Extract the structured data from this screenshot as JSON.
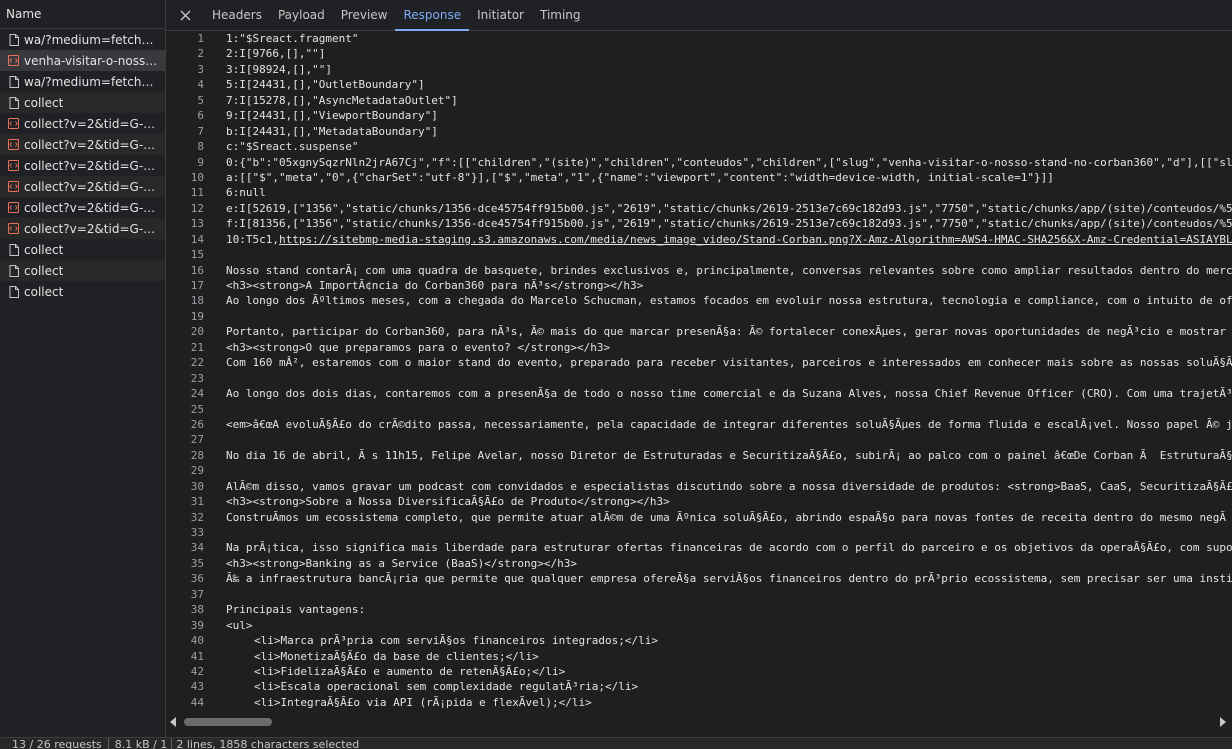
{
  "left_panel": {
    "header": "Name",
    "requests": [
      {
        "name": "wa/?medium=fetch&f...",
        "icon": "document-icon"
      },
      {
        "name": "venha-visitar-o-nosso-s...",
        "icon": "fetch-icon",
        "selected": true
      },
      {
        "name": "wa/?medium=fetch&f...",
        "icon": "document-icon"
      },
      {
        "name": "collect",
        "icon": "document-icon"
      },
      {
        "name": "collect?v=2&tid=G-99V...",
        "icon": "fetch-icon"
      },
      {
        "name": "collect?v=2&tid=G-99V...",
        "icon": "fetch-icon"
      },
      {
        "name": "collect?v=2&tid=G-99V...",
        "icon": "fetch-icon"
      },
      {
        "name": "collect?v=2&tid=G-99V...",
        "icon": "fetch-icon"
      },
      {
        "name": "collect?v=2&tid=G-99V...",
        "icon": "fetch-icon"
      },
      {
        "name": "collect?v=2&tid=G-99V...",
        "icon": "fetch-icon"
      },
      {
        "name": "collect",
        "icon": "document-icon"
      },
      {
        "name": "collect",
        "icon": "document-icon"
      },
      {
        "name": "collect",
        "icon": "document-icon"
      }
    ]
  },
  "tabs": {
    "items": [
      "Headers",
      "Payload",
      "Preview",
      "Response",
      "Initiator",
      "Timing"
    ],
    "active": "Response"
  },
  "response": {
    "lines": [
      {
        "n": "1",
        "t": "1:\"$Sreact.fragment\""
      },
      {
        "n": "2",
        "t": "2:I[9766,[],\"\"]"
      },
      {
        "n": "3",
        "t": "3:I[98924,[],\"\"]"
      },
      {
        "n": "4",
        "t": "5:I[24431,[],\"OutletBoundary\"]"
      },
      {
        "n": "5",
        "t": "7:I[15278,[],\"AsyncMetadataOutlet\"]"
      },
      {
        "n": "6",
        "t": "9:I[24431,[],\"ViewportBoundary\"]"
      },
      {
        "n": "7",
        "t": "b:I[24431,[],\"MetadataBoundary\"]"
      },
      {
        "n": "8",
        "t": "c:\"$Sreact.suspense\""
      },
      {
        "n": "9",
        "t": "0:{\"b\":\"05xgnySqzrNln2jrA67Cj\",\"f\":[[\"children\",\"(site)\",\"children\",\"conteudos\",\"children\",[\"slug\",\"venha-visitar-o-nosso-stand-no-corban360\",\"d\"],[[\"sl"
      },
      {
        "n": "10",
        "t": "a:[[\"$\",\"meta\",\"0\",{\"charSet\":\"utf-8\"}],[\"$\",\"meta\",\"1\",{\"name\":\"viewport\",\"content\":\"width=device-width, initial-scale=1\"}]]"
      },
      {
        "n": "11",
        "t": "6:null"
      },
      {
        "n": "12",
        "t": "e:I[52619,[\"1356\",\"static/chunks/1356-dce45754ff915b00.js\",\"2619\",\"static/chunks/2619-2513e7c69c182d93.js\",\"7750\",\"static/chunks/app/(site)/conteudos/%5"
      },
      {
        "n": "13",
        "t": "f:I[81356,[\"1356\",\"static/chunks/1356-dce45754ff915b00.js\",\"2619\",\"static/chunks/2619-2513e7c69c182d93.js\",\"7750\",\"static/chunks/app/(site)/conteudos/%5"
      },
      {
        "n": "14",
        "t": "10:T5c1,",
        "link": "https://sitebmp-media-staging.s3.amazonaws.com/media/news_image_video/Stand-Corban.png?X-Amz-Algorithm=AWS4-HMAC-SHA256&X-Amz-Credential=ASIAYBL"
      },
      {
        "n": "15",
        "t": ""
      },
      {
        "n": "16",
        "t": "Nosso stand contarÃ¡ com uma quadra de basquete, brindes exclusivos e, principalmente, conversas relevantes sobre como ampliar resultados dentro do merc"
      },
      {
        "n": "17",
        "t": "<h3><strong>A ImportÃ¢ncia do Corban360 para nÃ³s</strong></h3>"
      },
      {
        "n": "18",
        "t": "Ao longo dos Ãºltimos meses, com a chegada do Marcelo Schucman, estamos focados em evoluir nossa estrutura, tecnologia e compliance, com o intuito de of"
      },
      {
        "n": "19",
        "t": ""
      },
      {
        "n": "20",
        "t": "Portanto, participar do Corban360, para nÃ³s, Ã© mais do que marcar presenÃ§a: Ã© fortalecer conexÃµes, gerar novas oportunidades de negÃ³cio e mostrar"
      },
      {
        "n": "21",
        "t": "<h3><strong>O que preparamos para o evento? </strong></h3>"
      },
      {
        "n": "22",
        "t": "Com 160 mÂ², estaremos com o maior stand do evento, preparado para receber visitantes, parceiros e interessados em conhecer mais sobre as nossas soluÃ§Ã"
      },
      {
        "n": "23",
        "t": ""
      },
      {
        "n": "24",
        "t": "Ao longo dos dois dias, contaremos com a presenÃ§a de todo o nosso time comercial e da Suzana Alves, nossa Chief Revenue Officer (CRO). Com uma trajetÃ³"
      },
      {
        "n": "25",
        "t": ""
      },
      {
        "n": "26",
        "t": "<em>â€œA evoluÃ§Ã£o do crÃ©dito passa, necessariamente, pela capacidade de integrar diferentes soluÃ§Ãµes de forma fluida e escalÃ¡vel. Nosso papel Ã© j"
      },
      {
        "n": "27",
        "t": ""
      },
      {
        "n": "28",
        "t": "No dia 16 de abril, Ã s 11h15, Felipe Avelar, nosso Diretor de Estruturadas e SecuritizaÃ§Ã£o, subirÃ¡ ao palco com o painel â€œDe Corban Ã  EstruturaÃ§"
      },
      {
        "n": "29",
        "t": ""
      },
      {
        "n": "30",
        "t": "AlÃ©m disso, vamos gravar um podcast com convidados e especialistas discutindo sobre a nossa diversidade de produtos: <strong>BaaS, CaaS, SecuritizaÃ§Ã£"
      },
      {
        "n": "31",
        "t": "<h3><strong>Sobre a Nossa DiversificaÃ§Ã£o de Produto</strong></h3>"
      },
      {
        "n": "32",
        "t": "ConstruÃ­mos um ecossistema completo, que permite atuar alÃ©m de uma Ãºnica soluÃ§Ã£o, abrindo espaÃ§o para novas fontes de receita dentro do mesmo negÃ"
      },
      {
        "n": "33",
        "t": ""
      },
      {
        "n": "34",
        "t": "Na prÃ¡tica, isso significa mais liberdade para estruturar ofertas financeiras de acordo com o perfil do parceiro e os objetivos da operaÃ§Ã£o, com supo"
      },
      {
        "n": "35",
        "t": "<h3><strong>Banking as a Service (BaaS)</strong></h3>"
      },
      {
        "n": "36",
        "t": "Ã‰ a infraestrutura bancÃ¡ria que permite que qualquer empresa ofereÃ§a serviÃ§os financeiros dentro do prÃ³prio ecossistema, sem precisar ser uma insti"
      },
      {
        "n": "37",
        "t": ""
      },
      {
        "n": "38",
        "t": "Principais vantagens:"
      },
      {
        "n": "39",
        "t": "<ul>"
      },
      {
        "n": "40",
        "t": "<li>Marca prÃ³pria com serviÃ§os financeiros integrados;</li>",
        "indent": true
      },
      {
        "n": "41",
        "t": "<li>MonetizaÃ§Ã£o da base de clientes;</li>",
        "indent": true
      },
      {
        "n": "42",
        "t": "<li>FidelizaÃ§Ã£o e aumento de retenÃ§Ã£o;</li>",
        "indent": true
      },
      {
        "n": "43",
        "t": "<li>Escala operacional sem complexidade regulatÃ³ria;</li>",
        "indent": true
      },
      {
        "n": "44",
        "t": "<li>IntegraÃ§Ã£o via API (rÃ¡pida e flexÃ­vel);</li>",
        "indent": true
      }
    ]
  },
  "status": {
    "requests": "13 / 26 requests",
    "transferred": "8.1 kB / 1",
    "selection": "2 lines, 1858 characters selected"
  },
  "colors": {
    "accent": "#7cacf8",
    "fetch_icon": "#e8715b"
  }
}
